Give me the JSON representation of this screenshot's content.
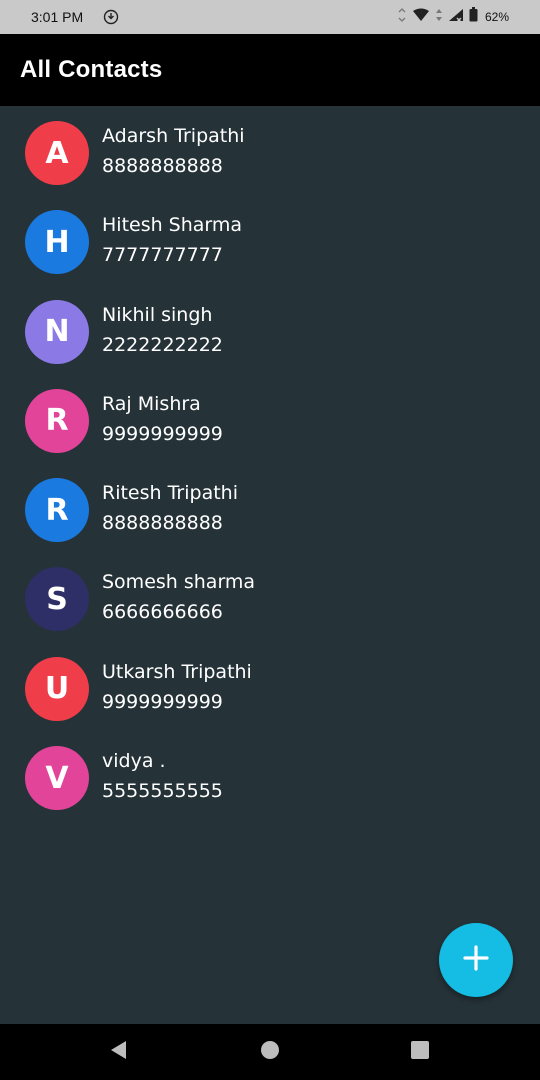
{
  "status_bar": {
    "time": "3:01 PM",
    "battery_percent": "62%",
    "icons": [
      "sync-icon",
      "vibrate-icon",
      "wifi-icon",
      "data-arrows-icon",
      "signal-icon",
      "battery-icon"
    ]
  },
  "app_bar": {
    "title": "All Contacts"
  },
  "contacts": [
    {
      "initial": "A",
      "name": "Adarsh Tripathi",
      "phone": "8888888888",
      "color": "#ef3e4a"
    },
    {
      "initial": "H",
      "name": "Hitesh Sharma",
      "phone": "7777777777",
      "color": "#1a7ae0"
    },
    {
      "initial": "N",
      "name": "Nikhil singh",
      "phone": "2222222222",
      "color": "#8b7ae6"
    },
    {
      "initial": "R",
      "name": "Raj Mishra",
      "phone": "9999999999",
      "color": "#e2449a"
    },
    {
      "initial": "R",
      "name": "Ritesh Tripathi",
      "phone": "8888888888",
      "color": "#1a7ae0"
    },
    {
      "initial": "S",
      "name": "Somesh sharma",
      "phone": "6666666666",
      "color": "#2e2f66"
    },
    {
      "initial": "U",
      "name": "Utkarsh Tripathi",
      "phone": "9999999999",
      "color": "#ef3e4a"
    },
    {
      "initial": "V",
      "name": "vidya .",
      "phone": "5555555555",
      "color": "#e2449a"
    }
  ],
  "fab": {
    "icon": "plus-icon",
    "color": "#15bce3"
  },
  "nav_bar": {
    "icons": [
      "back-icon",
      "home-icon",
      "recents-icon"
    ]
  },
  "colors": {
    "background": "#253238",
    "app_bar": "#000000",
    "status_bar": "#c9c9c9"
  }
}
